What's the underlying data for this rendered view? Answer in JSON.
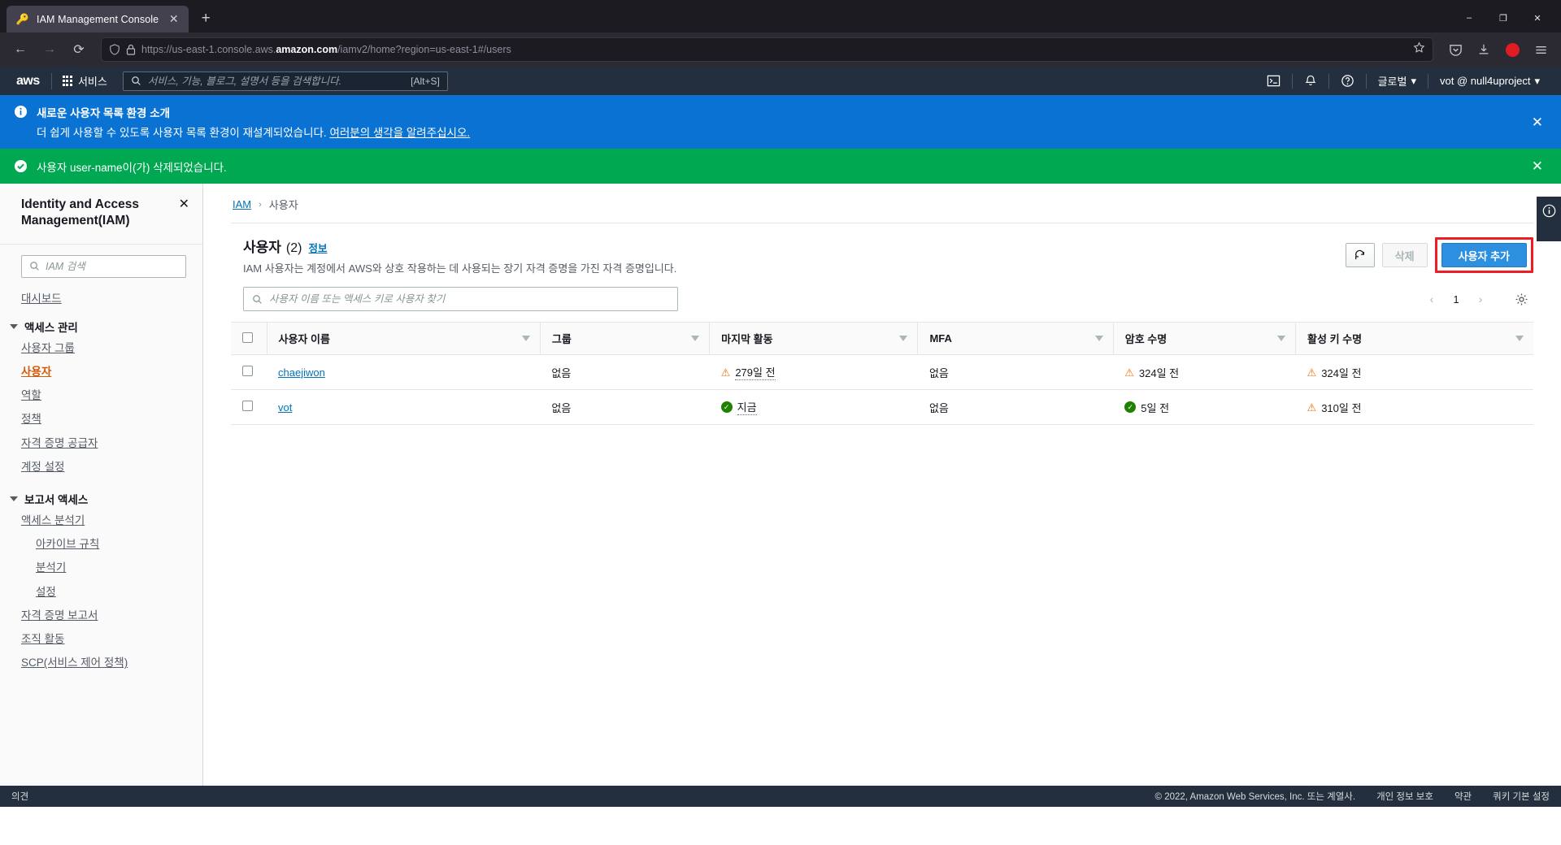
{
  "browser": {
    "tab": {
      "title": "IAM Management Console",
      "favicon": "key-icon"
    },
    "newtab_label": "+",
    "window_controls": {
      "minimize": "–",
      "maximize": "❐",
      "close": "✕"
    },
    "url": {
      "prefix": "https://us-east-1.console.aws.",
      "bold": "amazon.com",
      "suffix": "/iamv2/home?region=us-east-1#/users"
    },
    "nav": {
      "back": "←",
      "forward": "→",
      "reload": "⟳"
    }
  },
  "aws_header": {
    "logo": "aws",
    "services_label": "서비스",
    "search_placeholder": "서비스, 기능, 블로그, 설명서 등을 검색합니다.",
    "search_shortcut": "[Alt+S]",
    "region_label": "글로벌",
    "account_label": "vot @ null4uproject",
    "cloudshell_icon": "cloudshell-icon",
    "bell_icon": "bell-icon",
    "help_icon": "help-icon"
  },
  "banners": {
    "info": {
      "title": "새로운 사용자 목록 환경 소개",
      "text": "더 쉽게 사용할 수 있도록 사용자 목록 환경이 재설계되었습니다. ",
      "link": "여러분의 생각을 알려주십시오.",
      "close": "✕",
      "color": "#0972d3"
    },
    "success": {
      "text": "사용자 user-name이(가) 삭제되었습니다.",
      "close": "✕",
      "color": "#00a851"
    }
  },
  "sidebar": {
    "title": "Identity and Access Management(IAM)",
    "close": "✕",
    "search_placeholder": "IAM 검색",
    "items": [
      {
        "label": "대시보드",
        "type": "link",
        "active": false
      },
      {
        "label": "액세스 관리",
        "type": "group"
      },
      {
        "label": "사용자 그룹",
        "type": "link",
        "active": false
      },
      {
        "label": "사용자",
        "type": "link",
        "active": true
      },
      {
        "label": "역할",
        "type": "link",
        "active": false
      },
      {
        "label": "정책",
        "type": "link",
        "active": false
      },
      {
        "label": "자격 증명 공급자",
        "type": "link",
        "active": false
      },
      {
        "label": "계정 설정",
        "type": "link",
        "active": false
      },
      {
        "label": "보고서 액세스",
        "type": "group"
      },
      {
        "label": "액세스 분석기",
        "type": "link",
        "active": false
      },
      {
        "label": "아카이브 규칙",
        "type": "sublink",
        "active": false
      },
      {
        "label": "분석기",
        "type": "sublink",
        "active": false
      },
      {
        "label": "설정",
        "type": "sublink",
        "active": false
      },
      {
        "label": "자격 증명 보고서",
        "type": "link",
        "active": false
      },
      {
        "label": "조직 활동",
        "type": "link",
        "active": false
      },
      {
        "label": "SCP(서비스 제어 정책)",
        "type": "link",
        "active": false
      }
    ]
  },
  "breadcrumb": {
    "root": "IAM",
    "separator": "›",
    "current": "사용자"
  },
  "main": {
    "title": "사용자",
    "count": "(2)",
    "info_link": "정보",
    "description": "IAM 사용자는 계정에서 AWS와 상호 작용하는 데 사용되는 장기 자격 증명을 가진 자격 증명입니다.",
    "refresh_icon": "refresh-icon",
    "delete_label": "삭제",
    "add_user_label": "사용자 추가",
    "add_user_color": "#2d8fe0",
    "highlight_color": "#ee1c25",
    "search_placeholder": "사용자 이름 또는 액세스 키로 사용자 찾기",
    "pagination": {
      "prev": "‹",
      "page": "1",
      "next": "›"
    },
    "settings_icon": "gear-icon"
  },
  "table": {
    "columns": [
      "사용자 이름",
      "그룹",
      "마지막 활동",
      "MFA",
      "암호 수명",
      "활성 키 수명"
    ],
    "rows": [
      {
        "name": "chaejiwon",
        "group": "없음",
        "last_activity": {
          "text": "279일 전",
          "status": "warn",
          "dotted": true
        },
        "mfa": "없음",
        "password_age": {
          "text": "324일 전",
          "status": "warn"
        },
        "access_key_age": {
          "text": "324일 전",
          "status": "warn"
        }
      },
      {
        "name": "vot",
        "group": "없음",
        "last_activity": {
          "text": "지금",
          "status": "ok",
          "dotted": true
        },
        "mfa": "없음",
        "password_age": {
          "text": "5일 전",
          "status": "ok"
        },
        "access_key_age": {
          "text": "310일 전",
          "status": "warn"
        }
      }
    ]
  },
  "footer": {
    "feedback": "의견",
    "copyright": "© 2022, Amazon Web Services, Inc. 또는 계열사.",
    "links": [
      "개인 정보 보호",
      "약관",
      "쿼키 기본 설정"
    ]
  }
}
